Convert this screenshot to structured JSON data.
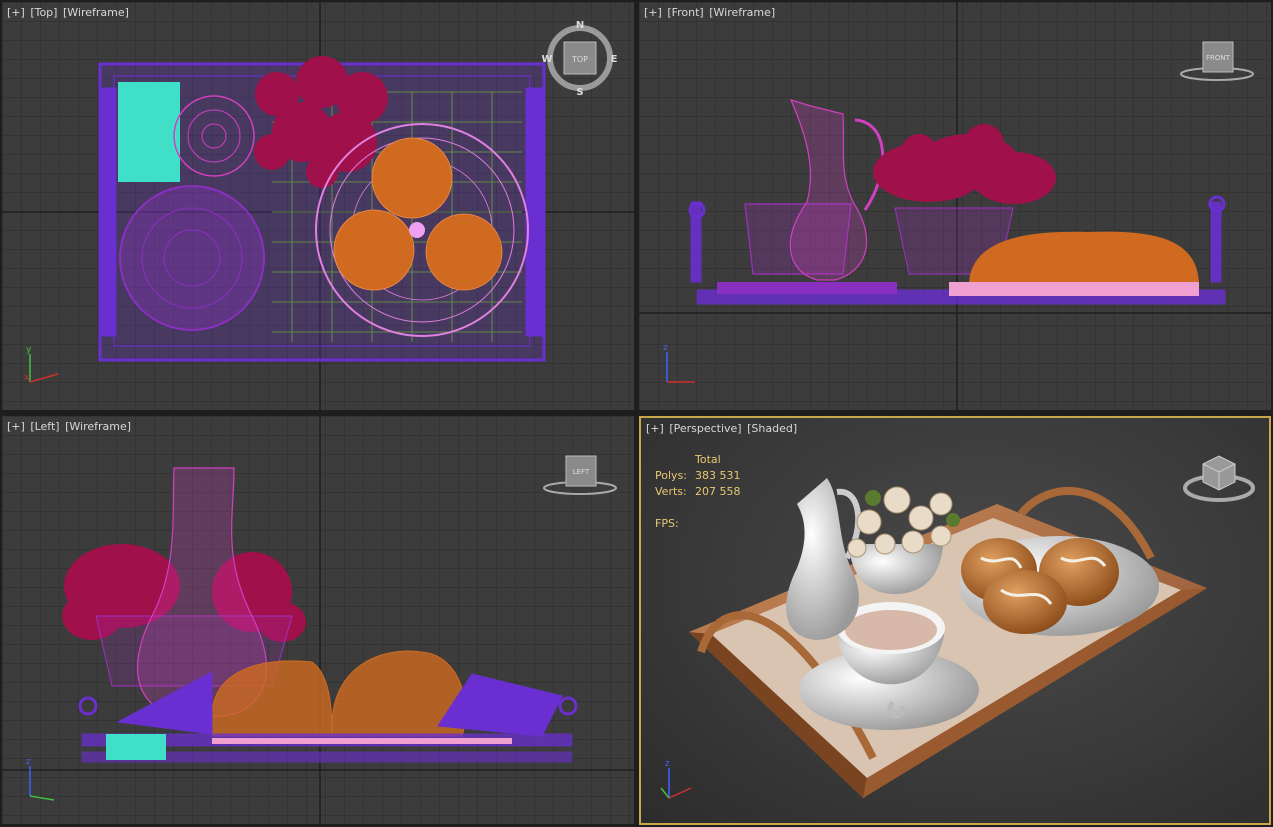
{
  "viewports": {
    "top": {
      "label_plus": "[+]",
      "label_view": "[Top]",
      "label_mode": "[Wireframe]",
      "cube_label": "TOP",
      "compass": {
        "n": "N",
        "s": "S",
        "e": "E",
        "w": "W"
      }
    },
    "front": {
      "label_plus": "[+]",
      "label_view": "[Front]",
      "label_mode": "[Wireframe]",
      "cube_label": "FRONT"
    },
    "left": {
      "label_plus": "[+]",
      "label_view": "[Left]",
      "label_mode": "[Wireframe]",
      "cube_label": "LEFT"
    },
    "persp": {
      "label_plus": "[+]",
      "label_view": "[Perspective]",
      "label_mode": "[Shaded]",
      "stats": {
        "total_label": "Total",
        "polys_label": "Polys:",
        "polys_value": "383 531",
        "verts_label": "Verts:",
        "verts_value": "207 558",
        "fps_label": "FPS:"
      }
    }
  },
  "axes": {
    "x": "x",
    "y": "y",
    "z": "z"
  },
  "colors": {
    "tray": "#6a2fd0",
    "flowers": "#a0104a",
    "buns": "#d06a20",
    "plate": "#e080e0",
    "jug": "#d040c0",
    "napkin": "#40e0c8",
    "active_border": "#c8a84a",
    "stats_text": "#e8c870"
  }
}
